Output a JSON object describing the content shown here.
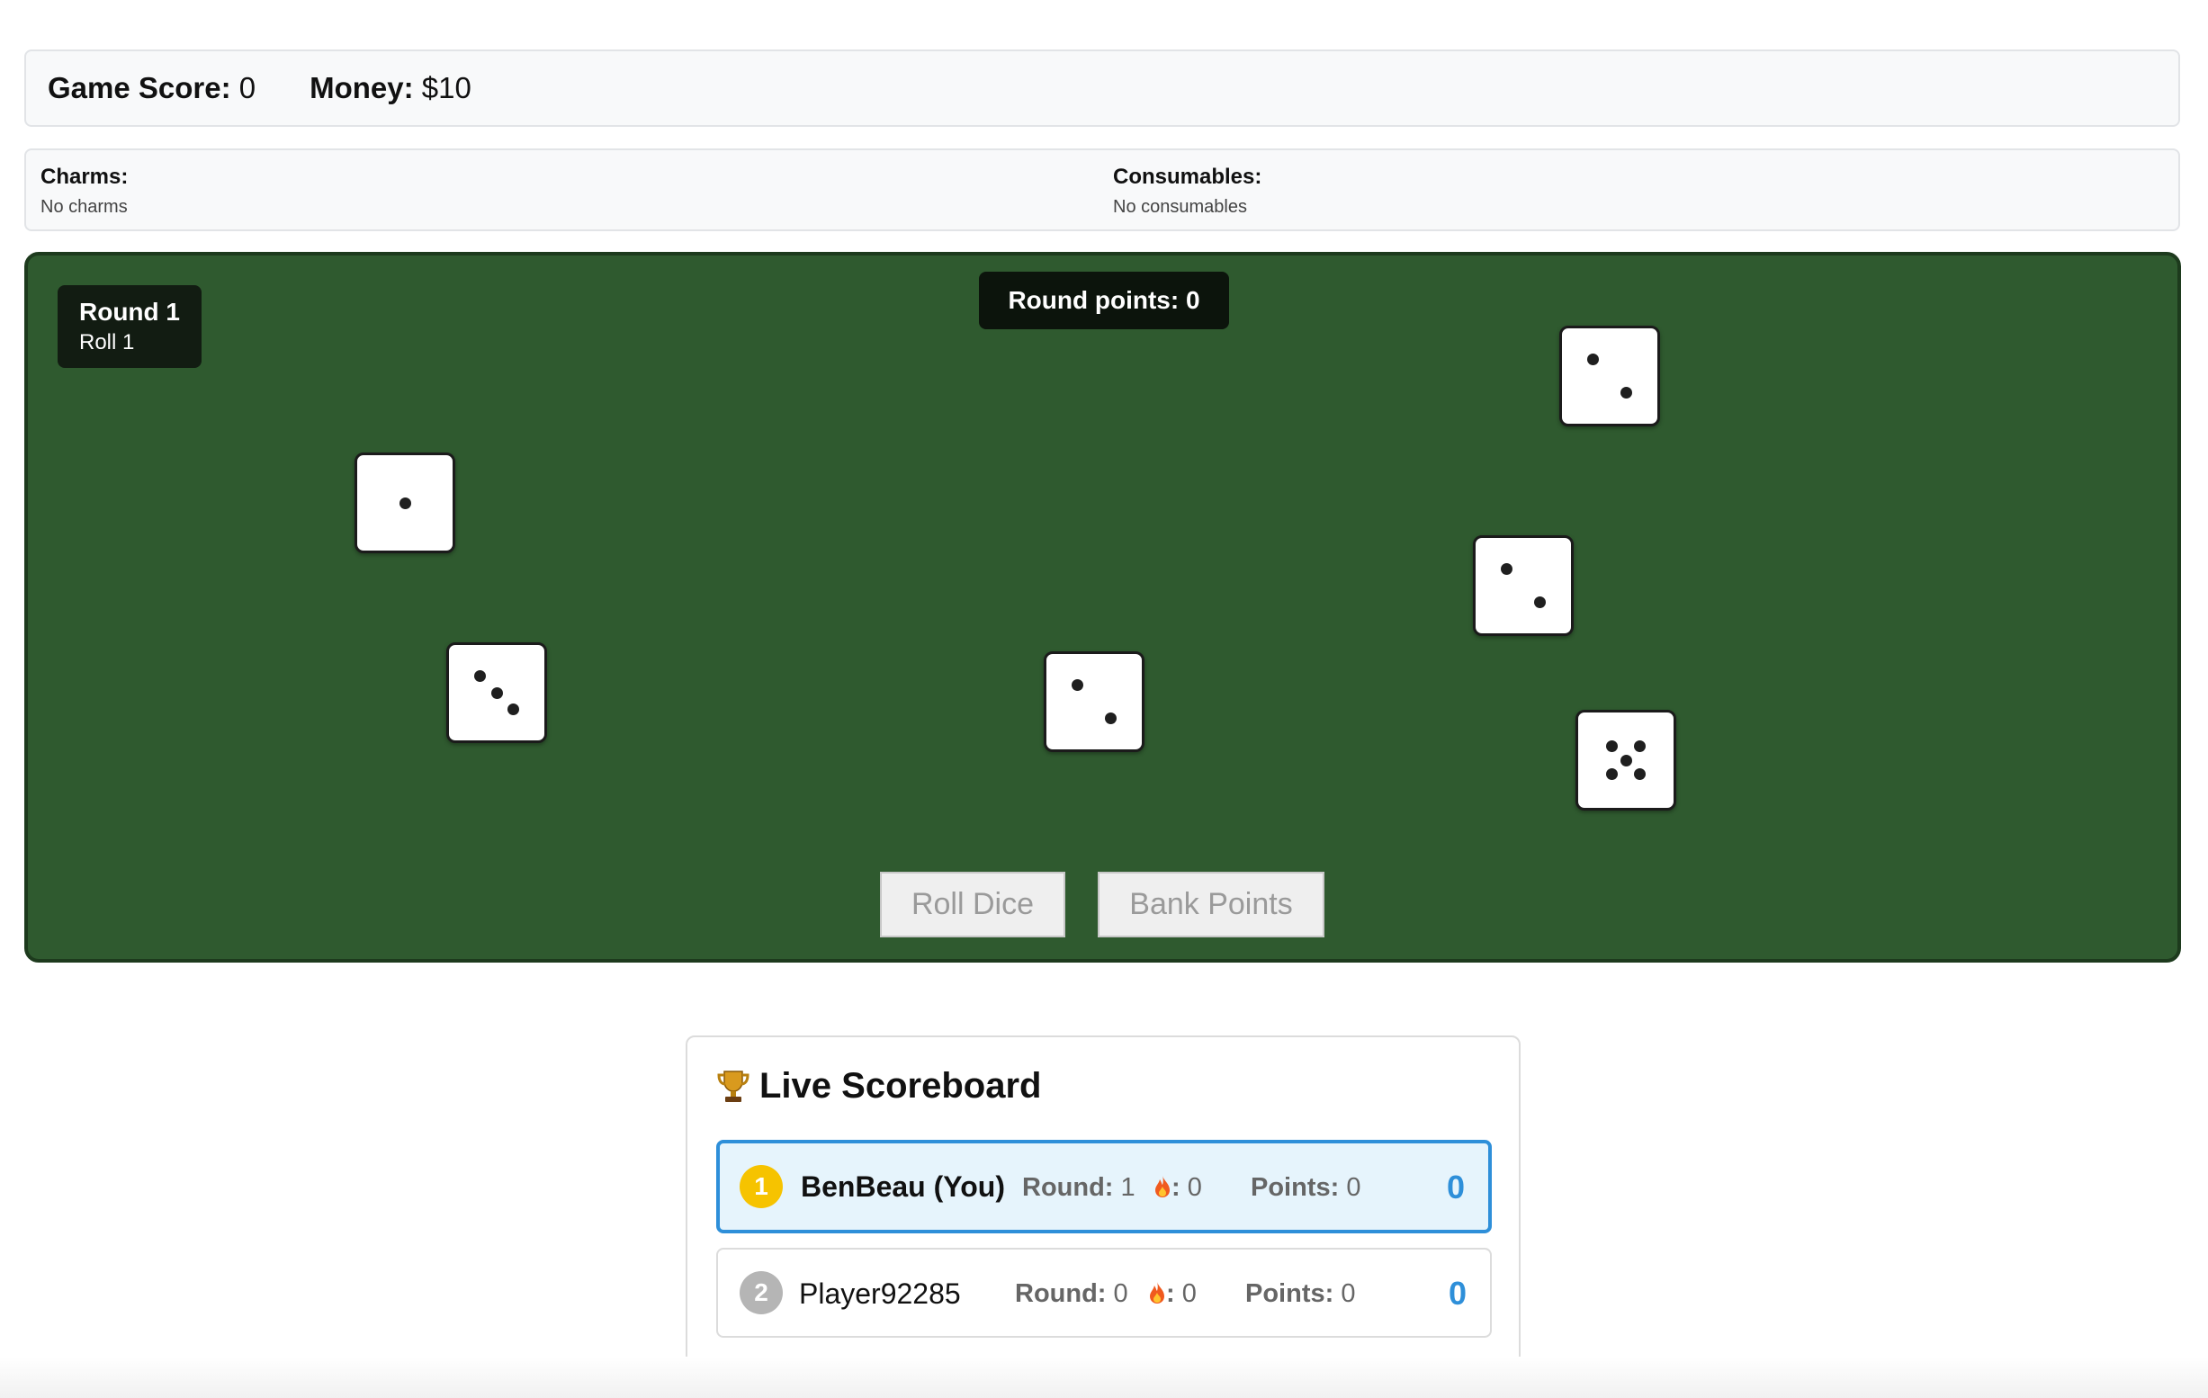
{
  "header": {
    "game_score_label": "Game Score:",
    "game_score_value": "0",
    "money_label": "Money:",
    "money_value": "$10"
  },
  "inventory": {
    "charms_label": "Charms:",
    "charms_value": "No charms",
    "consumables_label": "Consumables:",
    "consumables_value": "No consumables"
  },
  "table": {
    "round_label": "Round 1",
    "roll_label": "Roll 1",
    "round_points": "Round points: 0",
    "table_color": "#2f5a2f",
    "dice": [
      {
        "value": 1
      },
      {
        "value": 3
      },
      {
        "value": 2
      },
      {
        "value": 2
      },
      {
        "value": 2
      },
      {
        "value": 5
      }
    ],
    "roll_button": "Roll Dice",
    "bank_button": "Bank Points"
  },
  "scoreboard": {
    "title": "Live Scoreboard",
    "title_icon": "trophy-icon",
    "streak_icon": "fire-icon",
    "players": [
      {
        "rank": "1",
        "name": "BenBeau (You)",
        "round_label": "Round:",
        "round": "1",
        "streak_sep": ":",
        "streak": "0",
        "points_label": "Points:",
        "points": "0",
        "total": "0",
        "rank_color": "#f6c300"
      },
      {
        "rank": "2",
        "name": "Player92285",
        "round_label": "Round:",
        "round": "0",
        "streak_sep": ":",
        "streak": "0",
        "points_label": "Points:",
        "points": "0",
        "total": "0",
        "rank_color": "#b5b5b5"
      }
    ]
  }
}
